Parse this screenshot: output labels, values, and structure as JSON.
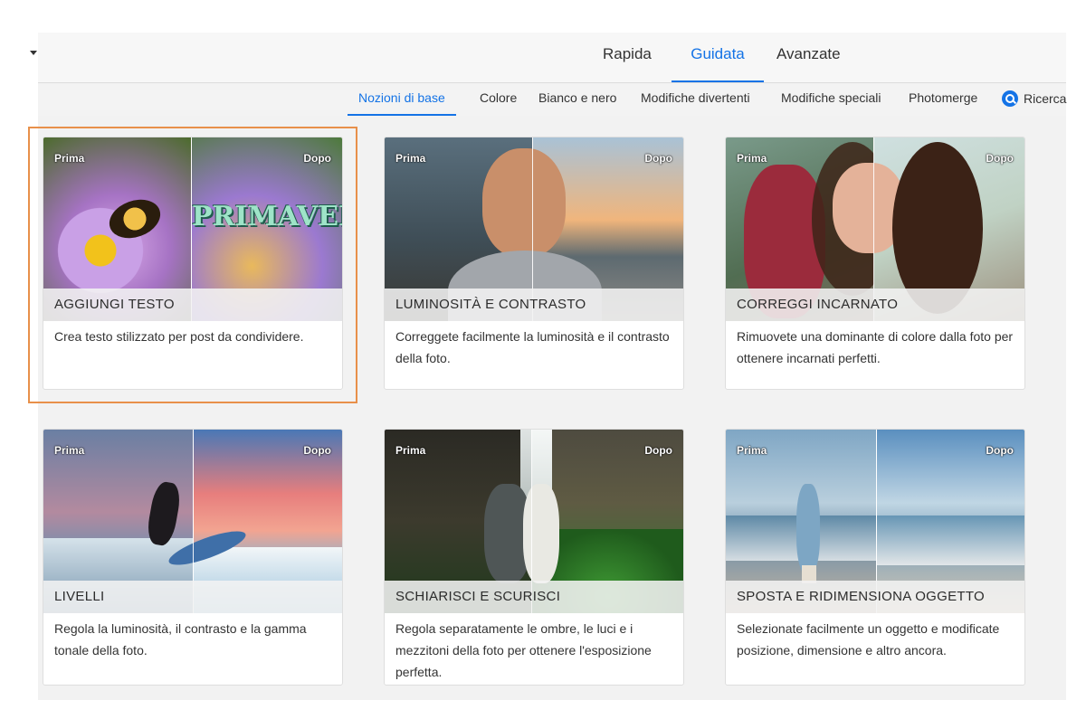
{
  "modes": [
    "Rapida",
    "Guidata",
    "Avanzate"
  ],
  "active_mode": "Guidata",
  "categories": [
    "Nozioni di base",
    "Colore",
    "Bianco e nero",
    "Modifiche divertenti",
    "Modifiche speciali",
    "Photomerge",
    "Ricerca"
  ],
  "active_category": "Nozioni di base",
  "badge_before": "Prima",
  "badge_after": "Dopo",
  "cards": [
    {
      "title": "AGGIUNGI TESTO",
      "description": "Crea testo stilizzato per post da condividere.",
      "overlay_text": "PRIMAVERA",
      "selected": true
    },
    {
      "title": "LUMINOSITÀ E CONTRASTO",
      "description": "Correggete facilmente la luminosità e il contrasto della foto.",
      "selected": false
    },
    {
      "title": "CORREGGI INCARNATO",
      "description": "Rimuovete una dominante di colore dalla foto per ottenere incarnati perfetti.",
      "selected": false
    },
    {
      "title": "LIVELLI",
      "description": "Regola la luminosità, il contrasto e la gamma tonale della foto.",
      "selected": false
    },
    {
      "title": "SCHIARISCI E SCURISCI",
      "description": "Regola separatamente le ombre, le luci e i mezzitoni della foto per ottenere l'esposizione perfetta.",
      "selected": false
    },
    {
      "title": "SPOSTA E RIDIMENSIONA OGGETTO",
      "description": "Selezionate facilmente un oggetto e modificate posizione, dimensione e altro ancora.",
      "selected": false
    }
  ],
  "colors": {
    "accent": "#1473e6",
    "selection": "#e8904a"
  }
}
